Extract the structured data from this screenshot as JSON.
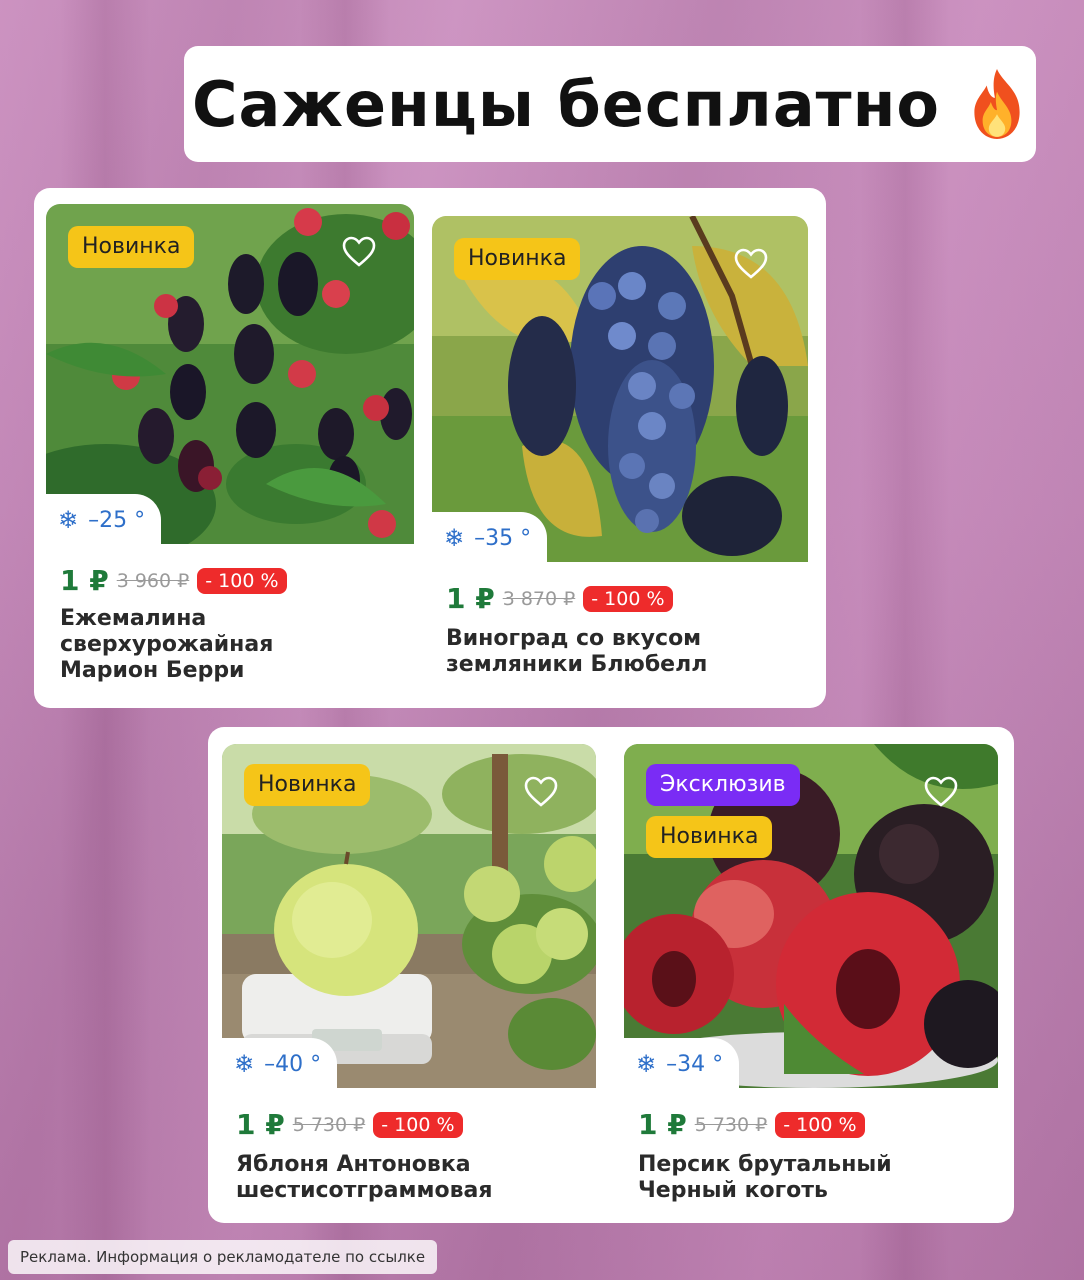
{
  "headline": {
    "title": "Саженцы бесплатно",
    "emoji": "🔥"
  },
  "products": [
    {
      "badges": [
        "Новинка"
      ],
      "frost": "–25 °",
      "price": "1 ₽",
      "old_price": "3 960 ₽",
      "discount": "- 100 %",
      "name": "Ежемалина сверхурожайная Марион Берри",
      "image": "blackberry-photo"
    },
    {
      "badges": [
        "Новинка"
      ],
      "frost": "–35 °",
      "price": "1 ₽",
      "old_price": "3 870 ₽",
      "discount": "- 100 %",
      "name": "Виноград со вкусом земляники Блюбелл",
      "image": "grape-photo"
    },
    {
      "badges": [
        "Новинка"
      ],
      "frost": "–40 °",
      "price": "1 ₽",
      "old_price": "5 730 ₽",
      "discount": "- 100 %",
      "name": "Яблоня Антоновка шестисотграммовая",
      "image": "apple-photo"
    },
    {
      "badges": [
        "Эксклюзив",
        "Новинка"
      ],
      "frost": "–34 °",
      "price": "1 ₽",
      "old_price": "5 730 ₽",
      "discount": "- 100 %",
      "name": "Персик брутальный Черный коготь",
      "image": "peach-photo"
    }
  ],
  "ad_note": "Реклама. Информация о рекламодателе по ссылке",
  "colors": {
    "price": "#1f7a3a",
    "discount": "#ee2b2b",
    "badge_new": "#f5c518",
    "badge_exclusive": "#7a2cf5",
    "frost": "#2e6fc9"
  }
}
